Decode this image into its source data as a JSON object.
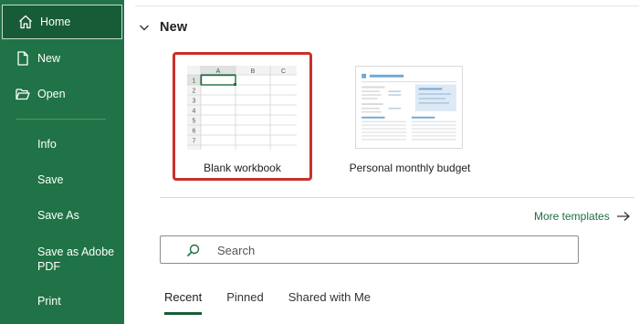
{
  "sidebar": {
    "items": [
      {
        "label": "Home",
        "icon": "home-icon",
        "active": true
      },
      {
        "label": "New",
        "icon": "new-document-icon"
      },
      {
        "label": "Open",
        "icon": "folder-open-icon"
      },
      {
        "label": "Info"
      },
      {
        "label": "Save"
      },
      {
        "label": "Save As"
      },
      {
        "label": "Save as Adobe PDF"
      },
      {
        "label": "Print"
      }
    ]
  },
  "main": {
    "section_title": "New",
    "tiles": [
      {
        "label": "Blank workbook",
        "selected": true
      },
      {
        "label": "Personal monthly budget"
      }
    ],
    "blank_thumb": {
      "columns": [
        "A",
        "B",
        "C"
      ],
      "rows": [
        "1",
        "2",
        "3",
        "4",
        "5",
        "6",
        "7"
      ]
    },
    "more_templates": "More templates",
    "search": {
      "placeholder": "Search"
    },
    "tabs": [
      {
        "label": "Recent",
        "active": true
      },
      {
        "label": "Pinned"
      },
      {
        "label": "Shared with Me"
      }
    ]
  },
  "colors": {
    "sidebar_bg": "#207346",
    "sidebar_active": "#185c37",
    "selection_border": "#c9302c",
    "link": "#1e6e42"
  }
}
